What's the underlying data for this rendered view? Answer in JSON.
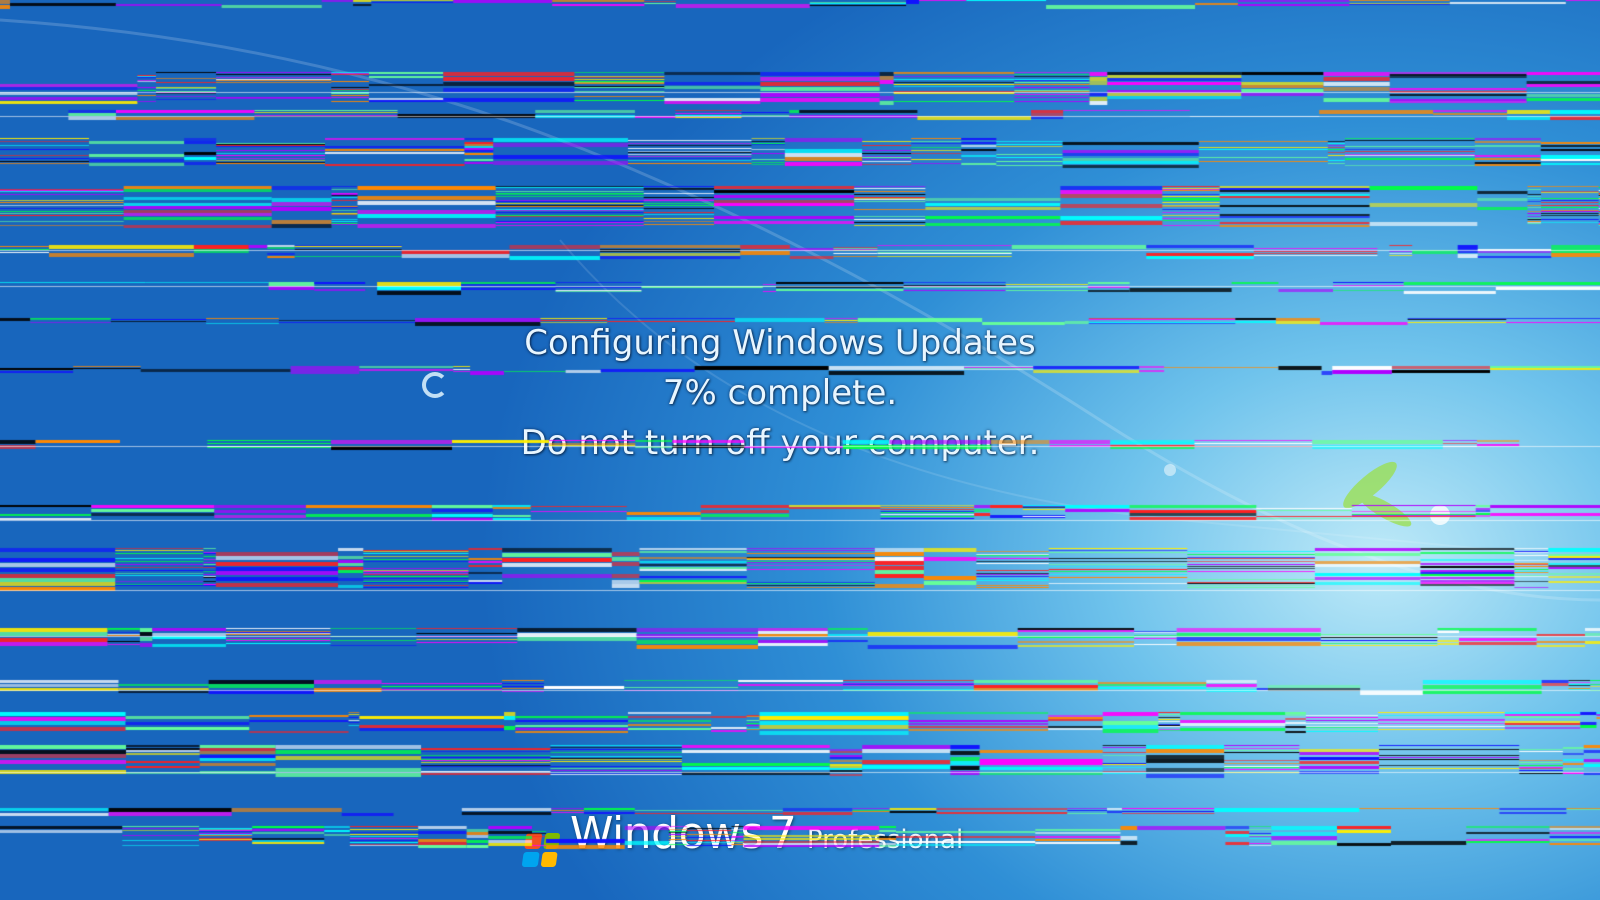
{
  "screen": {
    "title": "Configuring Windows Updates",
    "progress_text": "7% complete.",
    "warning": "Do not turn off your computer.",
    "progress_percent": 7
  },
  "branding": {
    "product": "Windows",
    "version": "7",
    "edition": "Professional",
    "icon": "windows-flag-icon",
    "flag_colors": [
      "#f25022",
      "#7fba00",
      "#00a4ef",
      "#ffb900"
    ]
  },
  "icons": {
    "spinner": "busy-spinner-icon"
  },
  "colors": {
    "background": "#1e78cc",
    "text": "#e8f6ff"
  }
}
